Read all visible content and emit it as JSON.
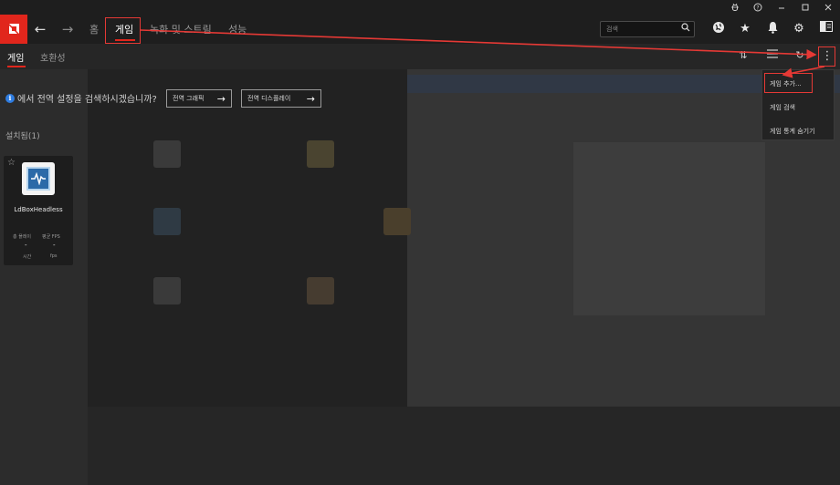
{
  "top_nav": {
    "home": "홈",
    "games": "게임",
    "record_stream": "녹화 및 스트림",
    "performance": "성능",
    "search_placeholder": "검색"
  },
  "sub_nav": {
    "tab_games": "게임",
    "tab_compat": "호환성"
  },
  "prompt": {
    "text": "에서 전역 설정을 검색하시겠습니까?",
    "global_graphics": "전역 그래픽",
    "global_display": "전역 디스플레이"
  },
  "installed": {
    "label": "설치됨(1)",
    "game": {
      "name": "LdBoxHeadless",
      "stat1_label": "총 플레이",
      "stat1_value": "-",
      "stat1_unit": "시간",
      "stat2_label": "평균 FPS",
      "stat2_value": "-",
      "stat2_unit": "fps"
    }
  },
  "menu": {
    "add_game": "게임 추가...",
    "scan_games": "게임 검색",
    "hide_stats": "게임 통계 숨기기"
  },
  "colors": {
    "accent": "#e1261c",
    "annotation": "#e53935",
    "info": "#2f7de1"
  }
}
